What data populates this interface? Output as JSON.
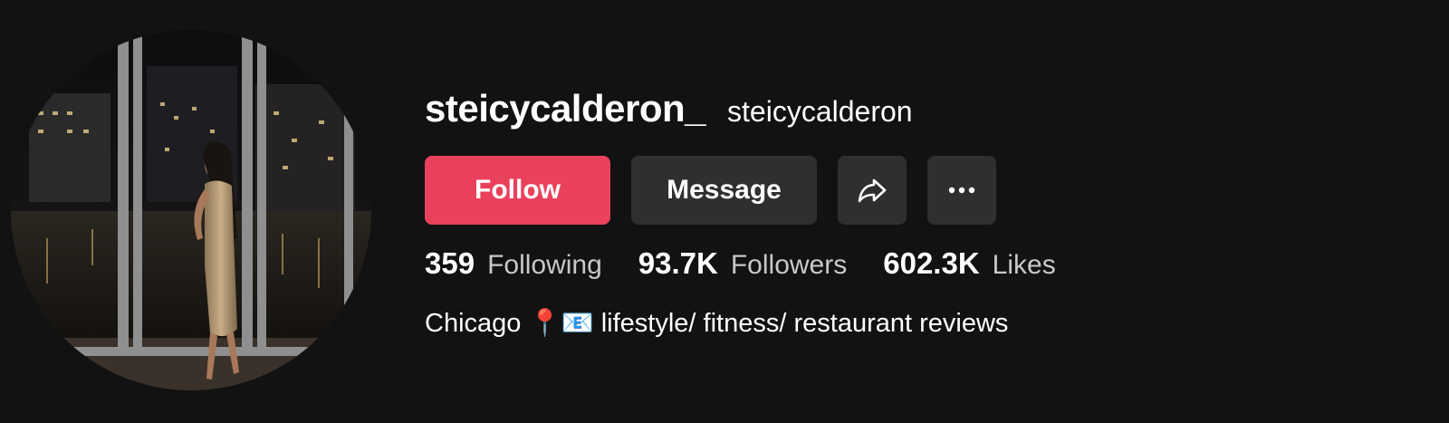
{
  "profile": {
    "username": "steicycalderon_",
    "nickname": "steicycalderon",
    "avatar_icon": "profile-photo"
  },
  "actions": {
    "follow_label": "Follow",
    "message_label": "Message",
    "share_icon": "share-arrow-icon",
    "more_icon": "more-options-icon"
  },
  "stats": {
    "following_count": "359",
    "following_label": "Following",
    "followers_count": "93.7K",
    "followers_label": "Followers",
    "likes_count": "602.3K",
    "likes_label": "Likes"
  },
  "bio": "Chicago 📍📧 lifestyle/ fitness/ restaurant reviews",
  "colors": {
    "background": "#121212",
    "follow_button": "#ea415c",
    "secondary_button": "#2f2f2f"
  }
}
